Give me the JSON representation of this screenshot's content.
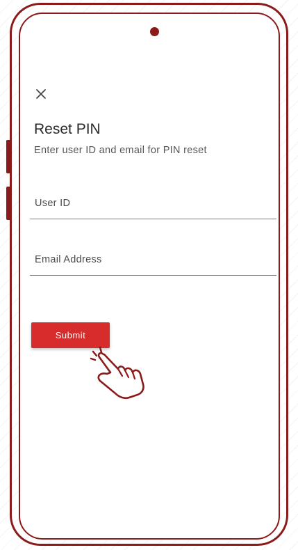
{
  "screen": {
    "title": "Reset PIN",
    "subtitle": "Enter user ID and email for PIN reset"
  },
  "form": {
    "user_id": {
      "value": "",
      "placeholder": "User ID"
    },
    "email": {
      "value": "",
      "placeholder": "Email Address"
    },
    "submit_label": "Submit"
  },
  "icons": {
    "close": "close-icon",
    "pointer": "hand-pointer-icon",
    "camera": "camera-dot"
  },
  "colors": {
    "frame": "#8b1a1a",
    "accent": "#d62c2c",
    "text": "#2a2a2a",
    "subtext": "#555555",
    "background": "#ffffff"
  }
}
